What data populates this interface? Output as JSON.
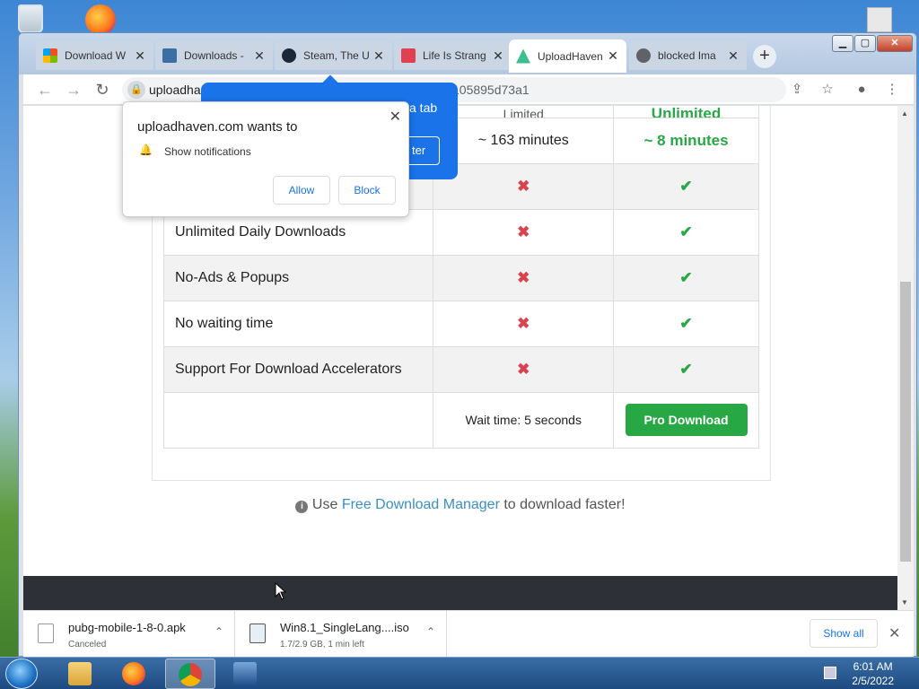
{
  "window": {
    "min_label": "▁",
    "max_label": "▢",
    "close_label": "✕"
  },
  "tabs": [
    {
      "label": "Download W",
      "favicon_color": "#f25022"
    },
    {
      "label": "Downloads -",
      "favicon_color": "#3a6ea5"
    },
    {
      "label": "Steam, The U",
      "favicon_color": "#1b2838"
    },
    {
      "label": "Life Is Strang",
      "favicon_color": "#e04050"
    },
    {
      "label": "UploadHaven",
      "favicon_color": "#3cbf8f"
    },
    {
      "label": "blocked Ima",
      "favicon_color": "#5f6368"
    }
  ],
  "newtab_label": "+",
  "tab_close": "✕",
  "toolbar": {
    "back": "←",
    "forward": "→",
    "reload": "↻",
    "url": "uploadha",
    "url_tail": "105895d73a1",
    "lock": "🔒",
    "share": "⇪",
    "star": "☆",
    "profile": "●",
    "menu": "⋮"
  },
  "blue_popup": {
    "text": "a tab",
    "button": "ter"
  },
  "notification": {
    "title": "uploadhaven.com wants to",
    "close": "✕",
    "bell": "🔔",
    "item": "Show notifications",
    "allow": "Allow",
    "block": "Block"
  },
  "table": {
    "header_partial_free": "Limited",
    "header_partial_pro": "Unlimited",
    "rows": [
      {
        "feature": "",
        "free": "~ 163 minutes",
        "pro": "~ 8 minutes",
        "type": "time"
      },
      {
        "feature": "",
        "free": "✖",
        "pro": "✔",
        "type": "mark"
      },
      {
        "feature": "Unlimited Daily Downloads",
        "free": "✖",
        "pro": "✔",
        "type": "mark"
      },
      {
        "feature": "No-Ads & Popups",
        "free": "✖",
        "pro": "✔",
        "type": "mark"
      },
      {
        "feature": "No waiting time",
        "free": "✖",
        "pro": "✔",
        "type": "mark"
      },
      {
        "feature": "Support For Download Accelerators",
        "free": "✖",
        "pro": "✔",
        "type": "mark"
      }
    ],
    "wait_time": "Wait time: 5 seconds",
    "pro_button": "Pro Download"
  },
  "hint": {
    "info": "i",
    "prefix": "Use ",
    "link": "Free Download Manager",
    "suffix": " to download faster!"
  },
  "downloads": [
    {
      "name": "pubg-mobile-1-8-0.apk",
      "status": "Canceled"
    },
    {
      "name": "Win8.1_SingleLang....iso",
      "status": "1.7/2.9 GB, 1 min left"
    }
  ],
  "download_chevron": "⌃",
  "show_all": "Show all",
  "downloads_close": "✕",
  "taskbar": {
    "time": "6:01 AM",
    "date": "2/5/2022"
  }
}
